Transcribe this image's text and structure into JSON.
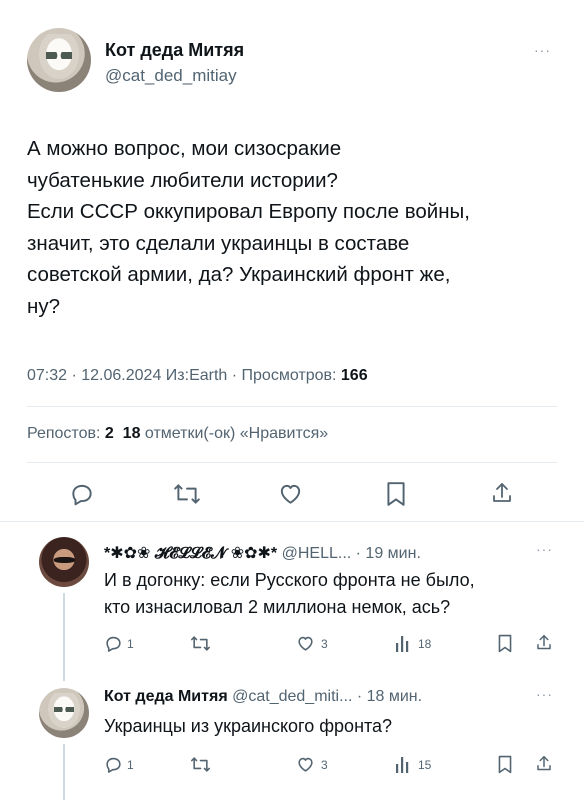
{
  "main_tweet": {
    "display_name": "Кот деда Митяя",
    "handle": "@cat_ded_mitiay",
    "text_lines": [
      "А можно вопрос, мои сизосракие",
      "чубатенькие любители истории?",
      "Если СССР оккупировал Европу после войны,",
      "значит, это сделали украинцы в составе",
      "советской армии, да? Украинский фронт же,",
      "ну?"
    ],
    "meta": "07:32 · 12.06.2024 Из:Earth · Просмотров: ",
    "views": "166",
    "stats": {
      "reposts_label": "Репостов: ",
      "reposts": "2",
      "likes": "18",
      "likes_label": " отметки(-ок) «Нравится»"
    }
  },
  "replies": [
    {
      "display_name": "*✱✿❀ 𝓗𝓔𝓛𝓛𝓔𝓝 ❀✿✱*",
      "handle_time": "@HELL... · 19 мин.",
      "text_lines": [
        "И в догонку: если Русского фронта не было,",
        "кто изнасиловал 2 миллиона немок, ась?"
      ],
      "counts": {
        "reply": "1",
        "like": "3",
        "views": "18"
      }
    },
    {
      "display_name": "Кот деда Митяя",
      "handle_time": "@cat_ded_miti... · 18 мин.",
      "text_lines": [
        "Украинцы из украинского фронта?"
      ],
      "counts": {
        "reply": "1",
        "like": "3",
        "views": "15"
      }
    }
  ],
  "more_glyph": "···",
  "icons": [
    "reply-icon",
    "repost-icon",
    "like-icon",
    "bookmark-icon",
    "share-icon",
    "views-icon"
  ]
}
